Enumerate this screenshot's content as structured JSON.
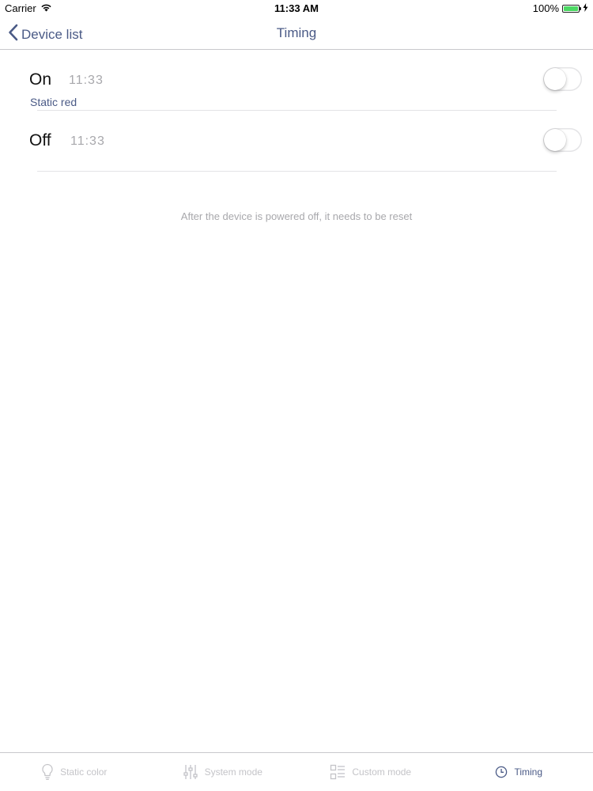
{
  "status_bar": {
    "carrier": "Carrier",
    "time": "11:33 AM",
    "battery": "100%",
    "battery_level": 1.0,
    "battery_color": "#4cd964"
  },
  "nav": {
    "back_label": "Device list",
    "title": "Timing",
    "accent_color": "#4a5a86"
  },
  "timers": [
    {
      "label": "On",
      "time": "11:33",
      "subtitle": "Static red",
      "enabled": false
    },
    {
      "label": "Off",
      "time": "11:33",
      "enabled": false
    }
  ],
  "notice": "After the device is powered off, it needs to be reset",
  "tabs": [
    {
      "label": "Static color",
      "icon": "lightbulb-icon",
      "active": false
    },
    {
      "label": "System mode",
      "icon": "sliders-icon",
      "active": false
    },
    {
      "label": "Custom mode",
      "icon": "list-icon",
      "active": false
    },
    {
      "label": "Timing",
      "icon": "clock-icon",
      "active": true
    }
  ]
}
